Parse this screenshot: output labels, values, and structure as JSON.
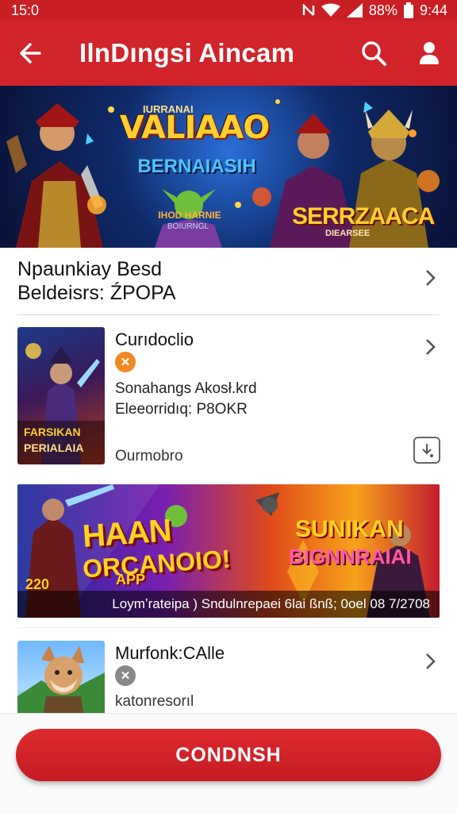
{
  "status_bar": {
    "time": "15:0",
    "battery": "88%",
    "clock": "9:44"
  },
  "app_bar": {
    "title": "IlnDıngsi Aincam"
  },
  "hero": {
    "title": "VALIAAO",
    "subtitle": "BERNAIASIH",
    "small_line": "IHOD HARNIE",
    "small_line2": "BOIURNGL",
    "right_title": "SERRZAACA",
    "right_sub": "DIEARSEE",
    "top_tag": "IURRANAI"
  },
  "row1": {
    "line1": "Npaunkiay Besd",
    "line2": "Beldeisrs: ŹPOPA"
  },
  "card1": {
    "title": "Curıdoclio",
    "line1": "Sonahangs Akosł.krd",
    "line2": "Eleeorridıq: P8OKR",
    "meta": "Ourmobro",
    "thumb_text1": "FARSIKAN",
    "thumb_text2": "PERIALAIA"
  },
  "promo": {
    "left_line1": "HAAN",
    "left_line2": "ORCANOIO!",
    "left_line3": "APP",
    "number": "220",
    "right_line1": "SUNIKAN",
    "right_line2": "BIGNNRAIAI",
    "caption": "Loymʼrateipa ) Sndulnrepaei 6lai ßnß; 0oel 08 7/2708"
  },
  "card2": {
    "title": "Murfonk:CAlle",
    "meta": "katonresorıl"
  },
  "cta": {
    "label": "CONDNSH"
  },
  "colors": {
    "primary": "#d1232a",
    "badge_orange": "#f08a24",
    "badge_gray": "#888888"
  }
}
